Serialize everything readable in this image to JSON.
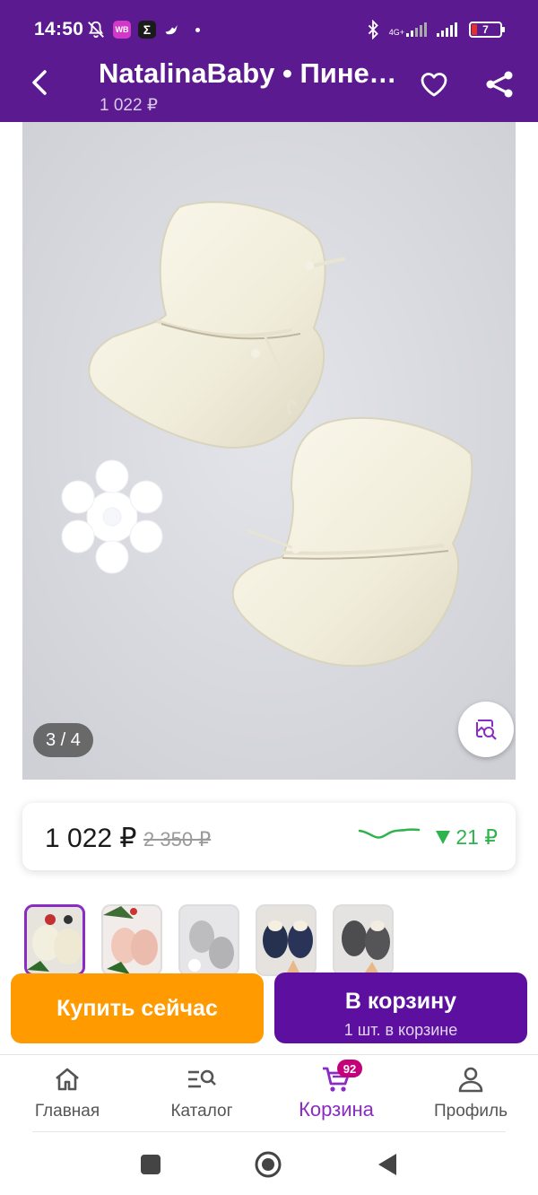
{
  "status_bar": {
    "time": "14:50",
    "wb_badge": "WB",
    "sigma_badge": "Σ",
    "network": "4G+",
    "battery": "7"
  },
  "header": {
    "title": "NatalinaBaby • Пинетки",
    "price": "1 022 ₽"
  },
  "gallery": {
    "counter": "3 / 4",
    "background": "#d9dadf"
  },
  "price_card": {
    "current": "1 022 ₽",
    "old": "2 350 ₽",
    "drop": "21 ₽",
    "drop_color": "#2fb34c"
  },
  "thumbnails": [
    {
      "colour": "#ece8da",
      "active": true
    },
    {
      "colour": "#efc9bd",
      "active": false
    },
    {
      "colour": "#bdbdbf",
      "active": false
    },
    {
      "colour": "#2a3358",
      "active": false
    },
    {
      "colour": "#4d4d4f",
      "active": false
    }
  ],
  "actions": {
    "buy_now": "Купить сейчас",
    "add_to_cart": "В корзину",
    "in_cart": "1 шт. в корзине"
  },
  "bottom_nav": {
    "home": "Главная",
    "catalog": "Каталог",
    "cart": "Корзина",
    "cart_count": "92",
    "profile": "Профиль"
  },
  "colors": {
    "brand": "#5b1a8f",
    "accent": "#8a2bc5",
    "buy_now": "#ff9a00",
    "cart_button": "#5d0fa0"
  }
}
